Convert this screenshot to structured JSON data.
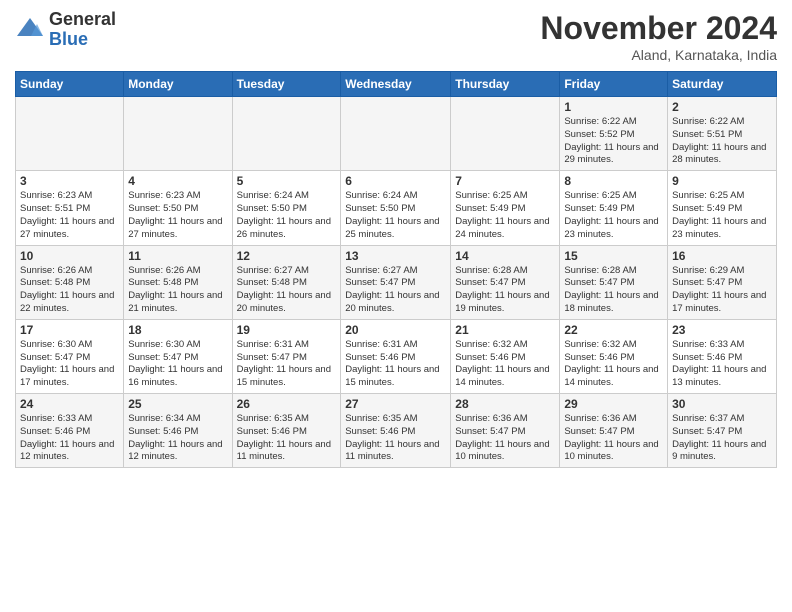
{
  "header": {
    "logo_general": "General",
    "logo_blue": "Blue",
    "title": "November 2024",
    "location": "Aland, Karnataka, India"
  },
  "weekdays": [
    "Sunday",
    "Monday",
    "Tuesday",
    "Wednesday",
    "Thursday",
    "Friday",
    "Saturday"
  ],
  "weeks": [
    [
      {
        "day": "",
        "info": ""
      },
      {
        "day": "",
        "info": ""
      },
      {
        "day": "",
        "info": ""
      },
      {
        "day": "",
        "info": ""
      },
      {
        "day": "",
        "info": ""
      },
      {
        "day": "1",
        "info": "Sunrise: 6:22 AM\nSunset: 5:52 PM\nDaylight: 11 hours and 29 minutes."
      },
      {
        "day": "2",
        "info": "Sunrise: 6:22 AM\nSunset: 5:51 PM\nDaylight: 11 hours and 28 minutes."
      }
    ],
    [
      {
        "day": "3",
        "info": "Sunrise: 6:23 AM\nSunset: 5:51 PM\nDaylight: 11 hours and 27 minutes."
      },
      {
        "day": "4",
        "info": "Sunrise: 6:23 AM\nSunset: 5:50 PM\nDaylight: 11 hours and 27 minutes."
      },
      {
        "day": "5",
        "info": "Sunrise: 6:24 AM\nSunset: 5:50 PM\nDaylight: 11 hours and 26 minutes."
      },
      {
        "day": "6",
        "info": "Sunrise: 6:24 AM\nSunset: 5:50 PM\nDaylight: 11 hours and 25 minutes."
      },
      {
        "day": "7",
        "info": "Sunrise: 6:25 AM\nSunset: 5:49 PM\nDaylight: 11 hours and 24 minutes."
      },
      {
        "day": "8",
        "info": "Sunrise: 6:25 AM\nSunset: 5:49 PM\nDaylight: 11 hours and 23 minutes."
      },
      {
        "day": "9",
        "info": "Sunrise: 6:25 AM\nSunset: 5:49 PM\nDaylight: 11 hours and 23 minutes."
      }
    ],
    [
      {
        "day": "10",
        "info": "Sunrise: 6:26 AM\nSunset: 5:48 PM\nDaylight: 11 hours and 22 minutes."
      },
      {
        "day": "11",
        "info": "Sunrise: 6:26 AM\nSunset: 5:48 PM\nDaylight: 11 hours and 21 minutes."
      },
      {
        "day": "12",
        "info": "Sunrise: 6:27 AM\nSunset: 5:48 PM\nDaylight: 11 hours and 20 minutes."
      },
      {
        "day": "13",
        "info": "Sunrise: 6:27 AM\nSunset: 5:47 PM\nDaylight: 11 hours and 20 minutes."
      },
      {
        "day": "14",
        "info": "Sunrise: 6:28 AM\nSunset: 5:47 PM\nDaylight: 11 hours and 19 minutes."
      },
      {
        "day": "15",
        "info": "Sunrise: 6:28 AM\nSunset: 5:47 PM\nDaylight: 11 hours and 18 minutes."
      },
      {
        "day": "16",
        "info": "Sunrise: 6:29 AM\nSunset: 5:47 PM\nDaylight: 11 hours and 17 minutes."
      }
    ],
    [
      {
        "day": "17",
        "info": "Sunrise: 6:30 AM\nSunset: 5:47 PM\nDaylight: 11 hours and 17 minutes."
      },
      {
        "day": "18",
        "info": "Sunrise: 6:30 AM\nSunset: 5:47 PM\nDaylight: 11 hours and 16 minutes."
      },
      {
        "day": "19",
        "info": "Sunrise: 6:31 AM\nSunset: 5:47 PM\nDaylight: 11 hours and 15 minutes."
      },
      {
        "day": "20",
        "info": "Sunrise: 6:31 AM\nSunset: 5:46 PM\nDaylight: 11 hours and 15 minutes."
      },
      {
        "day": "21",
        "info": "Sunrise: 6:32 AM\nSunset: 5:46 PM\nDaylight: 11 hours and 14 minutes."
      },
      {
        "day": "22",
        "info": "Sunrise: 6:32 AM\nSunset: 5:46 PM\nDaylight: 11 hours and 14 minutes."
      },
      {
        "day": "23",
        "info": "Sunrise: 6:33 AM\nSunset: 5:46 PM\nDaylight: 11 hours and 13 minutes."
      }
    ],
    [
      {
        "day": "24",
        "info": "Sunrise: 6:33 AM\nSunset: 5:46 PM\nDaylight: 11 hours and 12 minutes."
      },
      {
        "day": "25",
        "info": "Sunrise: 6:34 AM\nSunset: 5:46 PM\nDaylight: 11 hours and 12 minutes."
      },
      {
        "day": "26",
        "info": "Sunrise: 6:35 AM\nSunset: 5:46 PM\nDaylight: 11 hours and 11 minutes."
      },
      {
        "day": "27",
        "info": "Sunrise: 6:35 AM\nSunset: 5:46 PM\nDaylight: 11 hours and 11 minutes."
      },
      {
        "day": "28",
        "info": "Sunrise: 6:36 AM\nSunset: 5:47 PM\nDaylight: 11 hours and 10 minutes."
      },
      {
        "day": "29",
        "info": "Sunrise: 6:36 AM\nSunset: 5:47 PM\nDaylight: 11 hours and 10 minutes."
      },
      {
        "day": "30",
        "info": "Sunrise: 6:37 AM\nSunset: 5:47 PM\nDaylight: 11 hours and 9 minutes."
      }
    ]
  ]
}
